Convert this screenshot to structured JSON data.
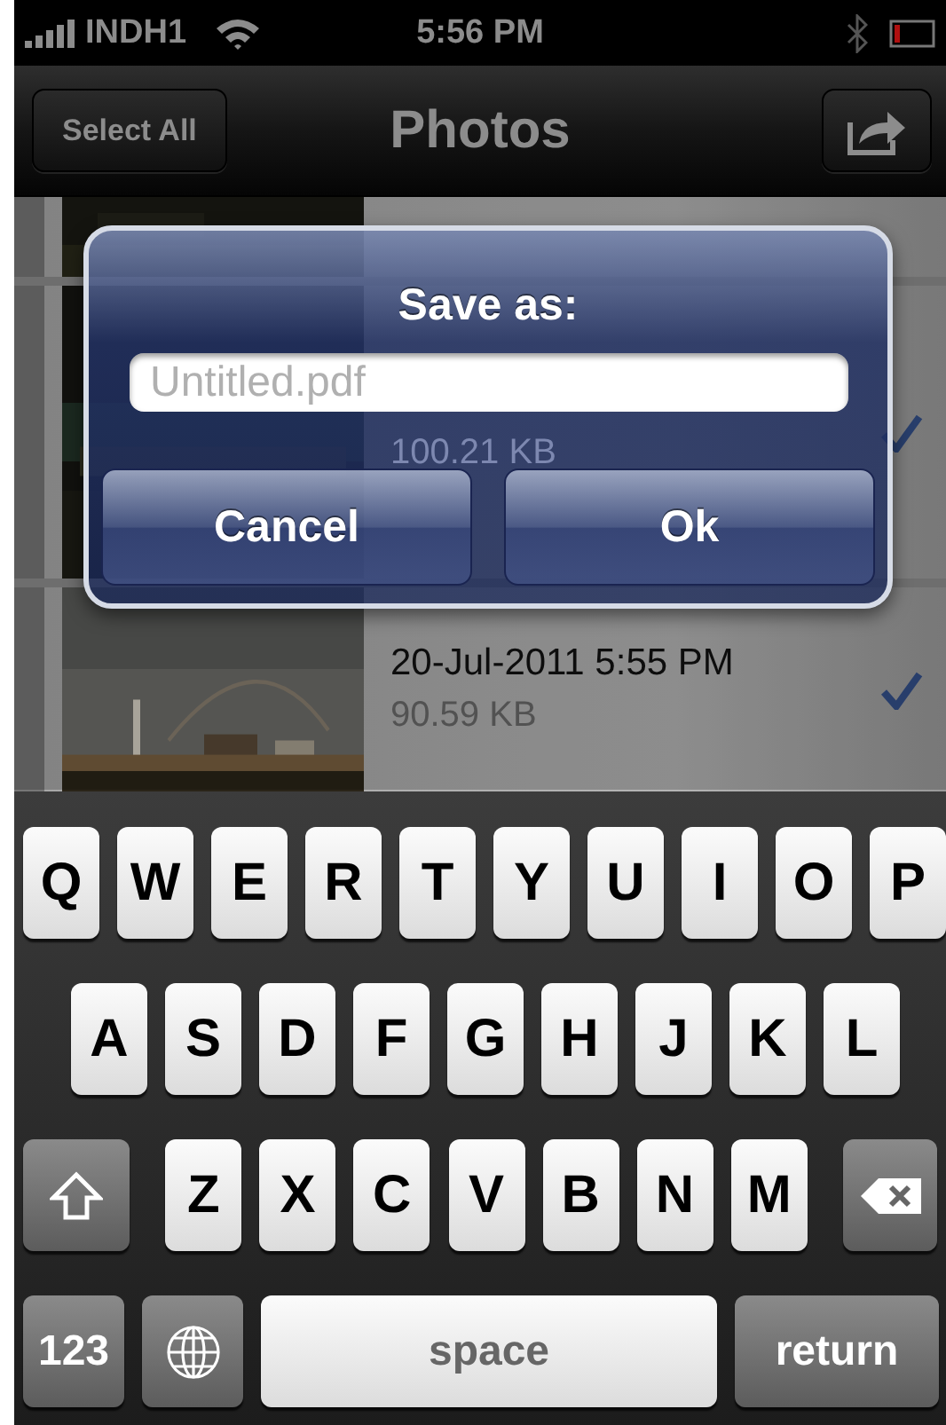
{
  "status_bar": {
    "carrier": "INDH1",
    "time": "5:56 PM"
  },
  "nav": {
    "left_button": "Select All",
    "title": "Photos"
  },
  "rows": [
    {
      "kind": "partial"
    },
    {
      "kind": "full",
      "size": "100.21 KB",
      "checked": true
    },
    {
      "kind": "full",
      "date": "20-Jul-2011 5:55 PM",
      "size": "90.59 KB",
      "checked": true
    }
  ],
  "dialog": {
    "title": "Save as:",
    "placeholder": "Untitled.pdf",
    "buttons": [
      "Cancel",
      "Ok"
    ]
  },
  "keyboard": {
    "rows": [
      [
        "Q",
        "W",
        "E",
        "R",
        "T",
        "Y",
        "U",
        "I",
        "O",
        "P"
      ],
      [
        "A",
        "S",
        "D",
        "F",
        "G",
        "H",
        "J",
        "K",
        "L"
      ],
      [
        "Z",
        "X",
        "C",
        "V",
        "B",
        "N",
        "M"
      ]
    ],
    "mode_key": "123",
    "space_key": "space",
    "return_key": "return"
  }
}
